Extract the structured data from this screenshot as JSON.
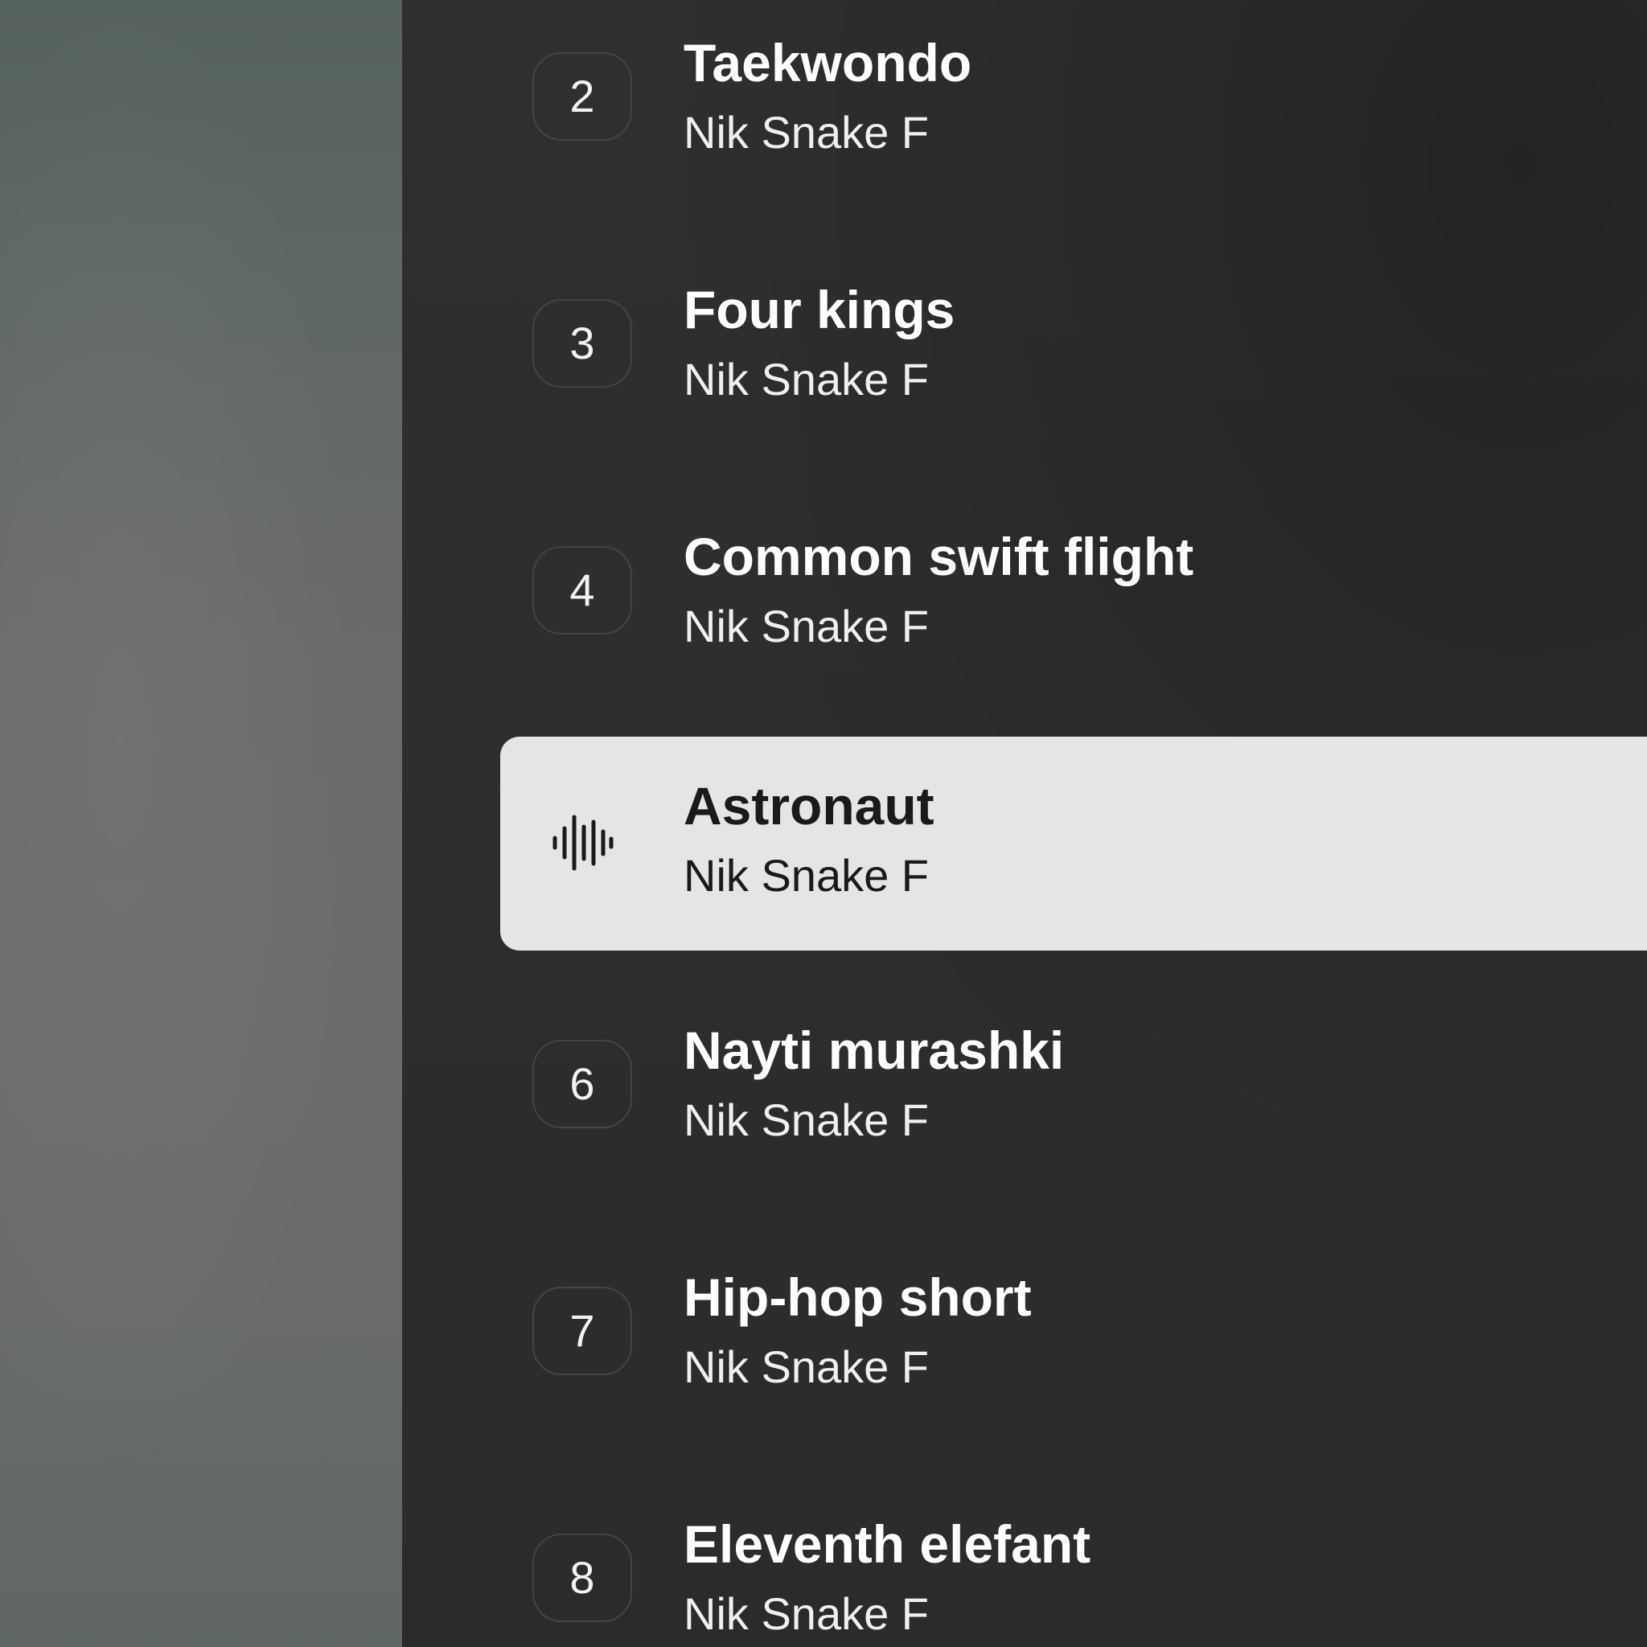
{
  "colors": {
    "panel_background": "#2c2c2c",
    "active_row_background": "#e5e5e5",
    "number_border": "#444444",
    "text_light": "#ffffff",
    "text_dark": "#1a1a1a"
  },
  "playlist": {
    "tracks": [
      {
        "number": "2",
        "title": "Taekwondo",
        "artist": "Nik Snake F",
        "playing": false
      },
      {
        "number": "3",
        "title": "Four kings",
        "artist": "Nik Snake F",
        "playing": false
      },
      {
        "number": "4",
        "title": "Common swift flight",
        "artist": "Nik Snake F",
        "playing": false
      },
      {
        "number": "",
        "title": "Astronaut",
        "artist": "Nik Snake F",
        "playing": true,
        "icon": "audio-waveform-icon"
      },
      {
        "number": "6",
        "title": "Nayti murashki",
        "artist": "Nik Snake F",
        "playing": false
      },
      {
        "number": "7",
        "title": "Hip-hop short",
        "artist": "Nik Snake F",
        "playing": false
      },
      {
        "number": "8",
        "title": "Eleventh elefant",
        "artist": "Nik Snake F",
        "playing": false
      }
    ]
  }
}
